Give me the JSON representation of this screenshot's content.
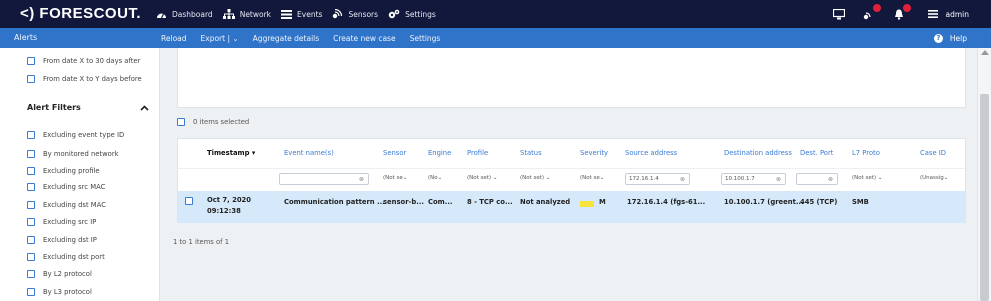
{
  "header": {
    "logo": "<) FORESCOUT.",
    "nav": [
      {
        "label": "Dashboard",
        "icon": "dashboard-icon"
      },
      {
        "label": "Network",
        "icon": "network-icon"
      },
      {
        "label": "Events",
        "icon": "events-list-icon"
      },
      {
        "label": "Sensors",
        "icon": "sensors-icon"
      },
      {
        "label": "Settings",
        "icon": "gears-icon"
      }
    ],
    "user": "admin"
  },
  "subbar": {
    "title": "Alerts",
    "actions": [
      "Reload",
      "Export | ⌄",
      "Aggregate details",
      "Create new case",
      "Settings"
    ],
    "help": "Help"
  },
  "sidebar": {
    "date_options": [
      "From date X to 30 days after",
      "From date X to Y days before"
    ],
    "filters_title": "Alert Filters",
    "filters": [
      "Excluding event type ID",
      "By monitored network",
      "Excluding profile",
      "Excluding src MAC",
      "Excluding dst MAC",
      "Excluding src IP",
      "Excluding dst IP",
      "Excluding dst port",
      "By L2 protocol",
      "By L3 protocol"
    ]
  },
  "table": {
    "selected_text": "0 items selected",
    "headers": [
      "Timestamp ▾",
      "Event name(s)",
      "Sensor",
      "Engine",
      "Profile",
      "Status",
      "Severity",
      "Source address",
      "Destination address",
      "Dest. Port",
      "L7 Proto",
      "Case ID"
    ],
    "filters": {
      "sensor": "(Not se⌄",
      "engine": "(No⌄",
      "profile": "(Not set) ⌄",
      "status": "(Not set) ⌄",
      "severity": "(Not se⌄",
      "source": "172.16.1.4",
      "destination": "10.100.1.7",
      "l7": "(Not set) ⌄",
      "case": "(Unassig⌄"
    },
    "row": {
      "timestamp_date": "Oct 7, 2020",
      "timestamp_time": "09:12:38",
      "event": "Communication pattern ...",
      "sensor": "sensor-b...",
      "engine": "Com...",
      "profile": "8 - TCP co...",
      "status": "Not analyzed",
      "severity": "M",
      "source": "172.16.1.4 (fgs-61...",
      "destination": "10.100.1.7 (greent...",
      "dest_port": "445 (TCP)",
      "l7": "SMB"
    },
    "pager": "1 to 1 items of 1"
  },
  "colors": {
    "header_bg": "#11183c",
    "subbar_bg": "#2f74c8",
    "row_selected": "#d6e9fb",
    "severity_medium": "#f6e43b",
    "link": "#3a7bd5"
  }
}
